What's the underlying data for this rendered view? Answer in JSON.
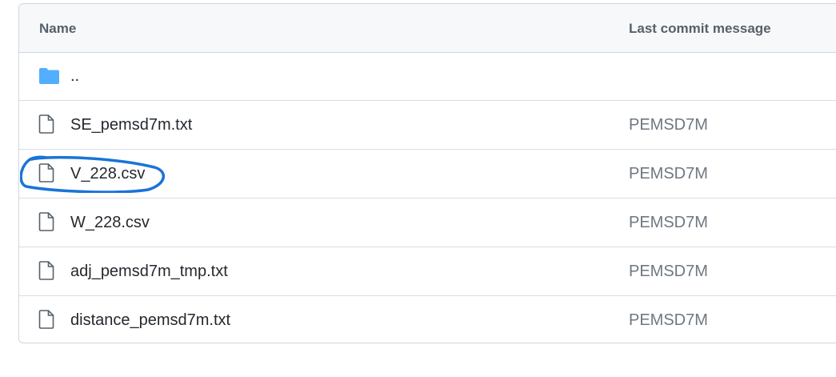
{
  "table": {
    "header": {
      "name": "Name",
      "last_commit_message": "Last commit message"
    },
    "rows": [
      {
        "name": "..",
        "commit": "",
        "icon": "folder-icon"
      },
      {
        "name": "SE_pemsd7m.txt",
        "commit": "PEMSD7M",
        "icon": "file-icon"
      },
      {
        "name": "V_228.csv",
        "commit": "PEMSD7M",
        "icon": "file-icon"
      },
      {
        "name": "W_228.csv",
        "commit": "PEMSD7M",
        "icon": "file-icon"
      },
      {
        "name": "adj_pemsd7m_tmp.txt",
        "commit": "PEMSD7M",
        "icon": "file-icon"
      },
      {
        "name": "distance_pemsd7m.txt",
        "commit": "PEMSD7M",
        "icon": "file-icon"
      }
    ]
  },
  "colors": {
    "folder": "#54aeff",
    "border": "#d0d7de",
    "annotation": "#1a73d9",
    "header_bg": "#f6f8fa"
  }
}
